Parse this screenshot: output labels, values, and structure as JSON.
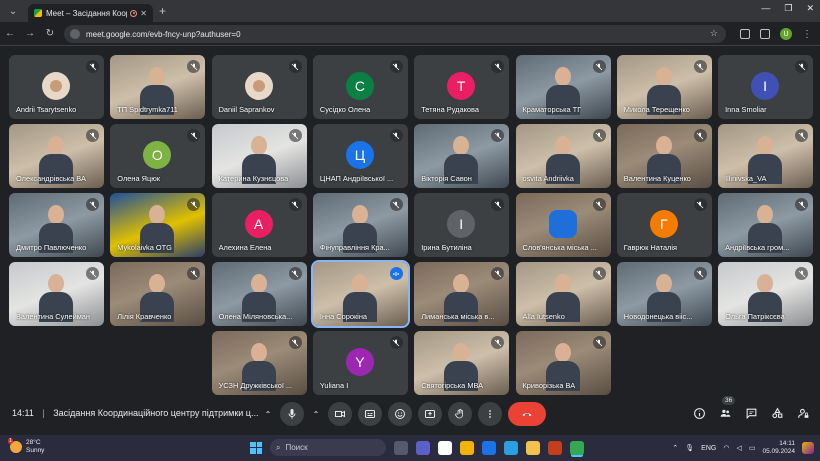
{
  "browser": {
    "tab_title": "Meet – Засідання Координ",
    "url": "meet.google.com/evb-fncy-unp?authuser=0",
    "profile_initial": "U"
  },
  "tiles": [
    {
      "name": "Andrii Tsarytsenko",
      "kind": "photo-avatar"
    },
    {
      "name": "ТП Spidtrymka711",
      "kind": "video"
    },
    {
      "name": "Daniil Saprankov",
      "kind": "photo-avatar"
    },
    {
      "name": "Сусідко Олена",
      "kind": "avatar",
      "letter": "С",
      "color": "#0b8043"
    },
    {
      "name": "Тетяна Рудакова",
      "kind": "avatar",
      "letter": "Т",
      "color": "#e91e63"
    },
    {
      "name": "Краматорська ТГ",
      "kind": "video"
    },
    {
      "name": "Микола Терещенко",
      "kind": "video"
    },
    {
      "name": "Inna Smoliar",
      "kind": "avatar",
      "letter": "I",
      "color": "#3f51b5"
    },
    {
      "name": "Олександрівська ВА",
      "kind": "video"
    },
    {
      "name": "Олена Яцюк",
      "kind": "avatar",
      "letter": "О",
      "color": "#7cb342"
    },
    {
      "name": "Катерина Кузнєцова",
      "kind": "video"
    },
    {
      "name": "ЦНАП Андріївської ...",
      "kind": "avatar",
      "letter": "Ц",
      "color": "#1a73e8"
    },
    {
      "name": "Вікторія Савон",
      "kind": "video"
    },
    {
      "name": "osvita Andriivka",
      "kind": "video"
    },
    {
      "name": "Валентина Куценко",
      "kind": "video"
    },
    {
      "name": "Illinivska_VA",
      "kind": "video"
    },
    {
      "name": "Дмитро Павлюченко",
      "kind": "video"
    },
    {
      "name": "Mykolaivka OTG",
      "kind": "video"
    },
    {
      "name": "Алехина Елена",
      "kind": "avatar",
      "letter": "А",
      "color": "#e91e63"
    },
    {
      "name": "Фінуправління Кра...",
      "kind": "video"
    },
    {
      "name": "Ірина Бутиліна",
      "kind": "avatar",
      "letter": "І",
      "color": "#5f6368"
    },
    {
      "name": "Слов'янська міська ...",
      "kind": "emblem"
    },
    {
      "name": "Гаврюк Наталія",
      "kind": "avatar",
      "letter": "Г",
      "color": "#f57c00"
    },
    {
      "name": "Андріївська гром...",
      "kind": "video"
    },
    {
      "name": "Валентина Сулейман",
      "kind": "video"
    },
    {
      "name": "Лілія Кравченко",
      "kind": "video"
    },
    {
      "name": "Олена Міляновська...",
      "kind": "video"
    },
    {
      "name": "Інна Сорокіна",
      "kind": "video",
      "speaking": true
    },
    {
      "name": "Лиманська міська в...",
      "kind": "video"
    },
    {
      "name": "Alla Iutsenko",
      "kind": "video"
    },
    {
      "name": "Новодонецька вііс...",
      "kind": "video"
    },
    {
      "name": "Ольга Патріксєва",
      "kind": "video"
    },
    {
      "name": "УСЗН Дружківської ...",
      "kind": "video"
    },
    {
      "name": "Yuliana I",
      "kind": "avatar",
      "letter": "Y",
      "color": "#9c27b0"
    },
    {
      "name": "Святогірська МВА",
      "kind": "video"
    },
    {
      "name": "Криворізька ВА",
      "kind": "video"
    }
  ],
  "meeting": {
    "time": "14:11",
    "separator": "|",
    "title": "Засідання Координаційного центру підтримки ц...",
    "participants_count": "36"
  },
  "taskbar": {
    "temperature": "28°C",
    "weather": "Sunny",
    "weather_badge": "1",
    "search_label": "Поиск",
    "language": "ENG",
    "time": "14:11",
    "date": "05.09.2024"
  }
}
